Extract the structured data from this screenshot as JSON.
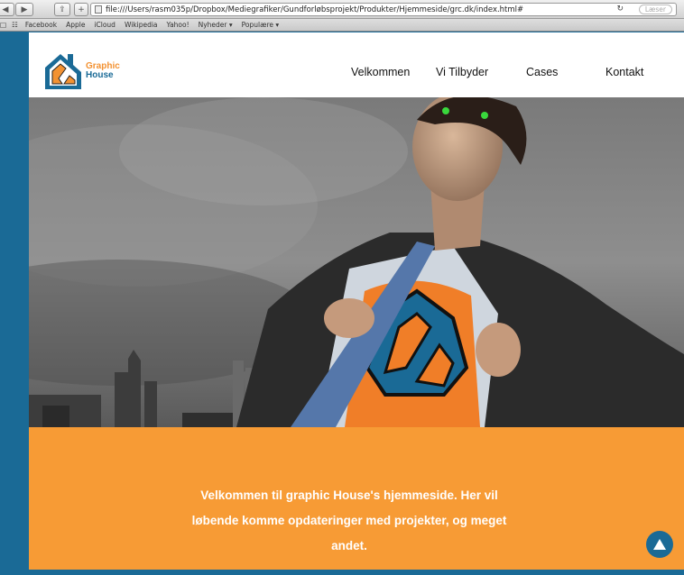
{
  "browser": {
    "url": "file:///Users/rasm035p/Dropbox/Mediegrafiker/Gundforløbsprojekt/Produkter/Hjemmeside/grc.dk/index.html#",
    "reader_label": "Læser",
    "bookmarks": [
      "Facebook",
      "Apple",
      "iCloud",
      "Wikipedia",
      "Yahoo!",
      "Nyheder ▾",
      "Populære ▾"
    ]
  },
  "site": {
    "logo": {
      "line1": "Graphic",
      "line2": "House"
    },
    "nav": [
      "Velkommen",
      "Vi Tilbyder",
      "Cases",
      "Kontakt"
    ],
    "welcome_text": "Velkommen til graphic House's hjemmeside. Her vil løbende komme opdateringer med projekter, og meget andet."
  },
  "colors": {
    "brand_blue": "#1a6a96",
    "brand_orange": "#f79b35"
  }
}
